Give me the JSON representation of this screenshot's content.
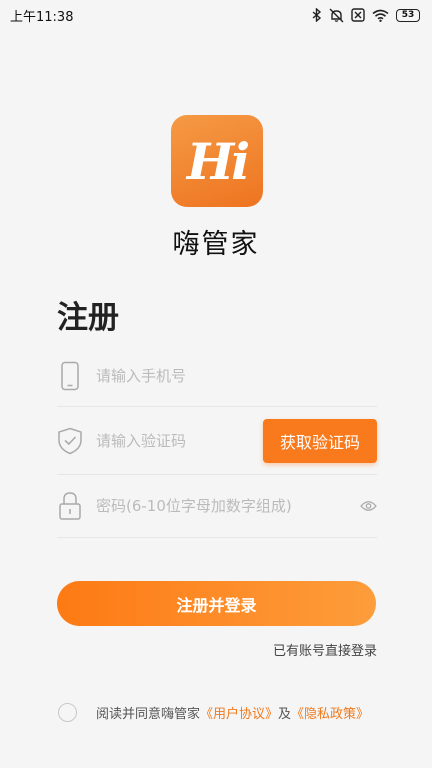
{
  "status_bar": {
    "time": "上午11:38",
    "battery": "53"
  },
  "app": {
    "logo_text": "Hi",
    "name": "嗨管家"
  },
  "page": {
    "title": "注册"
  },
  "form": {
    "phone_placeholder": "请输入手机号",
    "code_placeholder": "请输入验证码",
    "get_code_label": "获取验证码",
    "password_placeholder": "密码(6-10位字母加数字组成)",
    "submit_label": "注册并登录",
    "login_link": "已有账号直接登录"
  },
  "agreement": {
    "prefix": "阅读并同意嗨管家",
    "user_agreement": "《用户协议》",
    "and": "及",
    "privacy_policy": "《隐私政策》",
    "checked": false
  },
  "colors": {
    "accent": "#f97a1c",
    "background": "#f5f5f5"
  },
  "icons": [
    "bluetooth-icon",
    "mute-icon",
    "sim-off-icon",
    "wifi-icon",
    "phone-icon",
    "shield-check-icon",
    "lock-icon",
    "eye-icon"
  ]
}
